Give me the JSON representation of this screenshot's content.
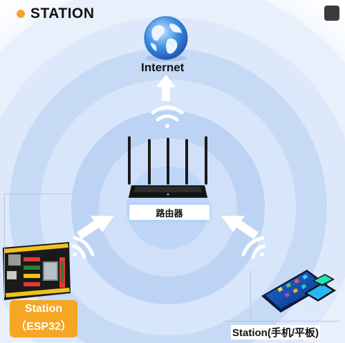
{
  "header": {
    "title": "STATION",
    "dot_color": "#f5a623"
  },
  "nodes": {
    "internet": {
      "label": "Internet"
    },
    "router": {
      "label": "路由器"
    },
    "esp32": {
      "label_line1": "Station",
      "label_line2": "（ESP32）"
    },
    "mobile": {
      "label": "Station(手机/平板)"
    }
  },
  "colors": {
    "arrow": "#ffffff",
    "wave": "#ffffff",
    "badge": "#f5a623",
    "ring_light": "#dde9fb",
    "ring_dark": "#bcd3f4"
  },
  "icons": [
    "globe-icon",
    "router-icon",
    "esp32-board-icon",
    "tablet-phone-icon",
    "wifi-signal-icon",
    "arrow-icon"
  ]
}
